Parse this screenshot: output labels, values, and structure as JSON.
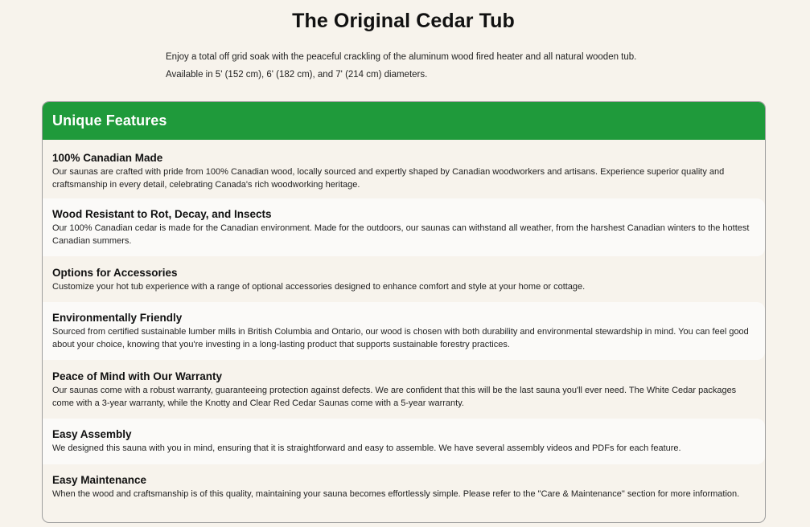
{
  "page": {
    "title": "The Original Cedar Tub",
    "intro_line1": "Enjoy a total off grid soak with the peaceful crackling of the aluminum wood fired heater and all natural wooden tub.",
    "intro_line2": "Available in 5' (152 cm), 6' (182 cm), and 7' (214 cm) diameters."
  },
  "features": {
    "heading": "Unique Features",
    "header_color": "#1f9a3b",
    "items": [
      {
        "title": "100% Canadian Made",
        "description": "Our saunas are crafted with pride from 100% Canadian wood, locally sourced and expertly shaped by Canadian woodworkers and artisans. Experience superior quality and craftsmanship in every detail, celebrating Canada's rich woodworking heritage."
      },
      {
        "title": "Wood Resistant to Rot, Decay, and Insects",
        "description": "Our 100% Canadian cedar is made for the Canadian environment. Made for the outdoors, our saunas can withstand all weather, from the harshest Canadian winters to the hottest Canadian summers."
      },
      {
        "title": "Options for Accessories",
        "description": "Customize your hot tub experience with a range of optional accessories designed to enhance comfort and style at your home or cottage."
      },
      {
        "title": "Environmentally Friendly",
        "description": "Sourced from certified sustainable lumber mills in British Columbia and Ontario, our wood is chosen with both durability and environmental stewardship in mind. You can feel good about your choice, knowing that you're investing in a long-lasting product that supports sustainable forestry practices."
      },
      {
        "title": "Peace of Mind with Our Warranty",
        "description": "Our saunas come with a robust warranty, guaranteeing protection against defects. We are confident that this will be the last sauna you'll ever need. The White Cedar packages come with a 3-year warranty, while the Knotty and Clear Red Cedar Saunas come with a 5-year warranty."
      },
      {
        "title": "Easy Assembly",
        "description": "We designed this sauna with you in mind, ensuring that it is straightforward and easy to assemble. We have several assembly videos and PDFs for each feature."
      },
      {
        "title": "Easy Maintenance",
        "description": "When the wood and craftsmanship is of this quality, maintaining your sauna becomes effortlessly simple. Please refer to the \"Care & Maintenance\" section for more information."
      }
    ]
  }
}
